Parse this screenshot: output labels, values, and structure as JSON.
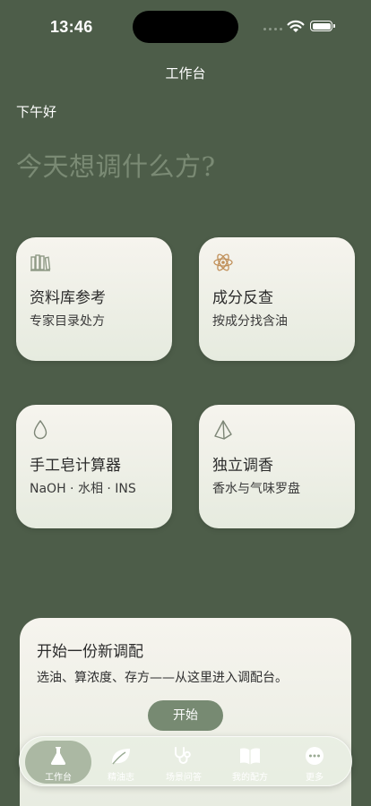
{
  "status_bar": {
    "time": "13:46"
  },
  "nav": {
    "title": "工作台"
  },
  "greeting": "下午好",
  "headline": "今天想调什么方?",
  "cards": [
    {
      "icon": "books-icon",
      "title": "资料库参考",
      "subtitle": "专家目录处方"
    },
    {
      "icon": "atom-icon",
      "title": "成分反查",
      "subtitle": "按成分找含油"
    },
    {
      "icon": "droplet-icon",
      "title": "手工皂计算器",
      "subtitle": "NaOH · 水相 · INS"
    },
    {
      "icon": "pyramid-icon",
      "title": "独立调香",
      "subtitle": "香水与气味罗盘"
    }
  ],
  "start_panel": {
    "title": "开始一份新调配",
    "description": "选油、算浓度、存方——从这里进入调配台。",
    "button_label": "开始"
  },
  "tab_bar": {
    "active_index": 0,
    "tabs": [
      {
        "label": "工作台",
        "icon": "flask-icon"
      },
      {
        "label": "精油志",
        "icon": "leaf-icon"
      },
      {
        "label": "场景问答",
        "icon": "stethoscope-icon"
      },
      {
        "label": "我的配方",
        "icon": "book-icon"
      },
      {
        "label": "更多",
        "icon": "more-icon"
      }
    ]
  },
  "colors": {
    "background": "#4d5d49",
    "card": "#f2f1ea",
    "accent_button": "#778a72",
    "headline": "#7a8a74",
    "atom_icon": "#c0905a"
  }
}
